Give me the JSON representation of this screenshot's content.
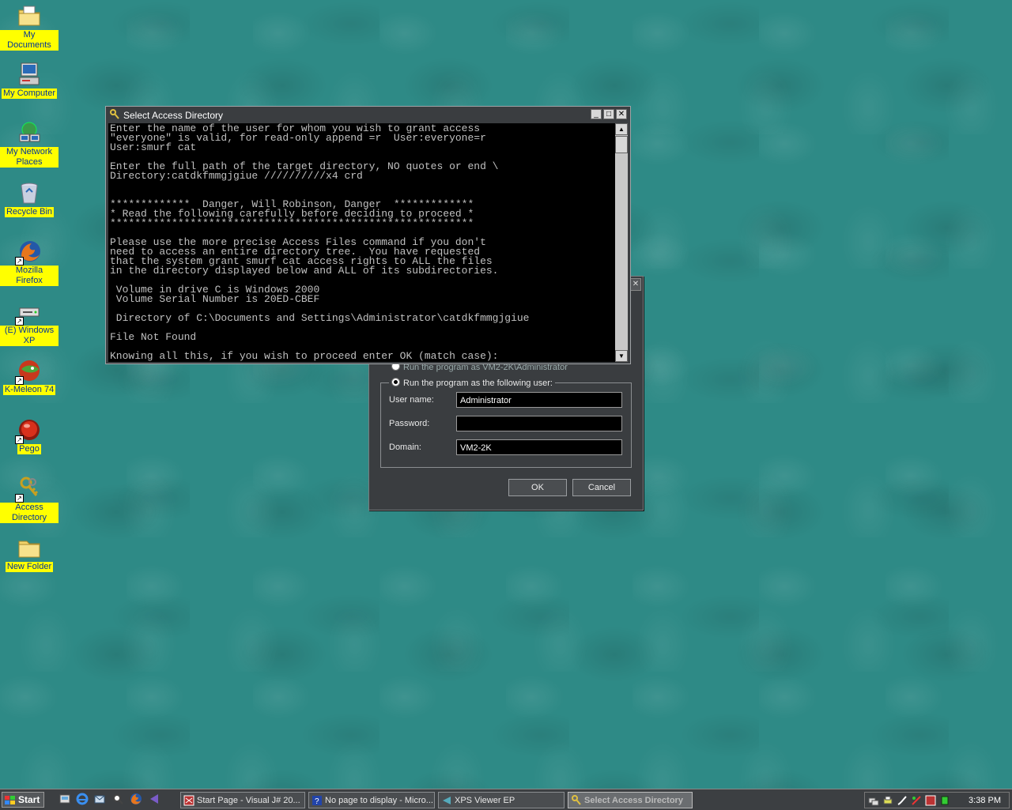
{
  "desktop": {
    "icons": [
      {
        "label": "My Documents",
        "icon": "folder-documents-icon"
      },
      {
        "label": "My Computer",
        "icon": "computer-icon"
      },
      {
        "label": "My Network Places",
        "icon": "network-icon"
      },
      {
        "label": "Recycle Bin",
        "icon": "recycle-bin-icon"
      },
      {
        "label": "Mozilla Firefox",
        "icon": "firefox-icon"
      },
      {
        "label": "(E) Windows XP",
        "icon": "cd-drive-icon"
      },
      {
        "label": "K-Meleon 74",
        "icon": "k-meleon-icon"
      },
      {
        "label": "Pego",
        "icon": "pego-icon"
      },
      {
        "label": "Access Directory",
        "icon": "keys-icon"
      },
      {
        "label": "New Folder",
        "icon": "folder-icon"
      }
    ]
  },
  "console": {
    "title": "Select Access Directory",
    "lines": [
      "Enter the name of the user for whom you wish to grant access",
      "\"everyone\" is valid, for read-only append =r  User:everyone=r",
      "User:smurf cat",
      "",
      "Enter the full path of the target directory, NO quotes or end \\",
      "Directory:catdkfmmgjgiue //////////x4 crd",
      "",
      "",
      "*************  Danger, Will Robinson, Danger  *************",
      "* Read the following carefully before deciding to proceed *",
      "***********************************************************",
      "",
      "Please use the more precise Access Files command if you don't",
      "need to access an entire directory tree.  You have requested",
      "that the system grant smurf cat access rights to ALL the files",
      "in the directory displayed below and ALL of its subdirectories.",
      "",
      " Volume in drive C is Windows 2000",
      " Volume Serial Number is 20ED-CBEF",
      "",
      " Directory of C:\\Documents and Settings\\Administrator\\catdkfmmgjgiue",
      "",
      "File Not Found",
      "",
      "Knowing all this, if you wish to proceed enter OK (match case):"
    ]
  },
  "runas": {
    "partial_option": "Run the program as VM2-2K\\Administrator",
    "option_label": "Run the program as the following user:",
    "username_label": "User name:",
    "username_value": "Administrator",
    "password_label": "Password:",
    "password_value": "",
    "domain_label": "Domain:",
    "domain_value": "VM2-2K",
    "ok_label": "OK",
    "cancel_label": "Cancel"
  },
  "taskbar": {
    "start_label": "Start",
    "tasks": [
      {
        "label": "Start Page - Visual J# 20...",
        "icon": "visual-studio-icon"
      },
      {
        "label": "No page to display - Micro...",
        "icon": "help-icon"
      },
      {
        "label": "XPS Viewer EP",
        "icon": "xps-viewer-icon"
      },
      {
        "label": "Select Access Directory",
        "icon": "keys-icon"
      }
    ],
    "clock": "3:38 PM"
  }
}
